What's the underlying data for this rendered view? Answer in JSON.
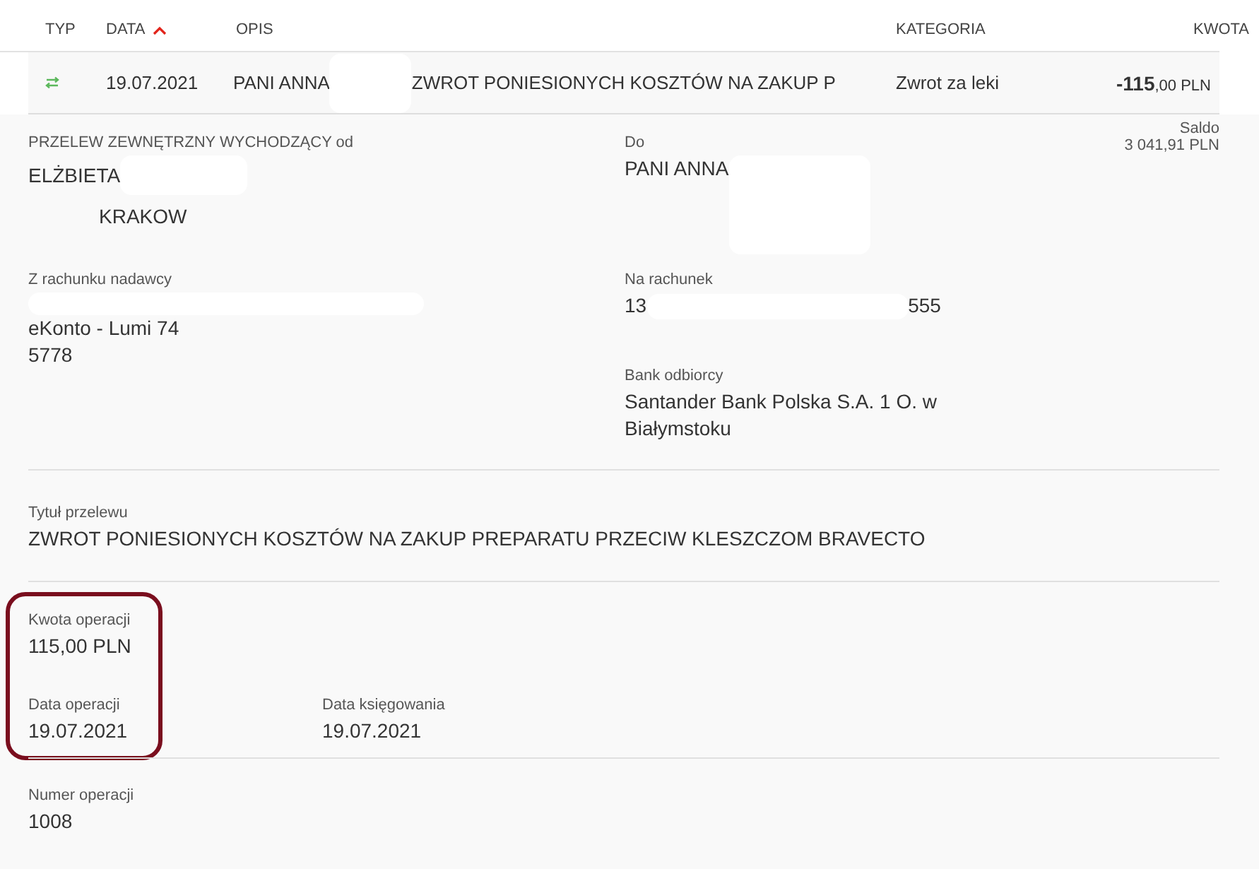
{
  "table": {
    "columns": [
      {
        "label": "TYP",
        "sorted": false
      },
      {
        "label": "DATA",
        "sorted": true
      },
      {
        "label": "OPIS",
        "sorted": false
      },
      {
        "label": "KATEGORIA",
        "sorted": false
      },
      {
        "label": "KWOTA",
        "sorted": false
      }
    ],
    "row": {
      "date": "19.07.2021",
      "name": "PANI ANNA",
      "description": "ZWROT PONIESIONYCH KOSZTÓW NA ZAKUP P",
      "category": "Zwrot za leki",
      "amount": "**-115**,00 PLN"
    }
  },
  "details": {
    "sender": {
      "label": "PRZELEW ZEWNĘTRZNY WYCHODZĄCY od",
      "name": "ELŻBIETA",
      "city": "KRAKOW"
    },
    "recipient": {
      "label": "Do",
      "name": "PANI ANNA"
    },
    "balance": {
      "label": "Saldo",
      "value": "3 041,91 PLN"
    },
    "from_account": {
      "label": "Z rachunku nadawcy",
      "lines": [
        "eKonto - Lumi 74",
        "5778"
      ]
    },
    "to_account": {
      "label": "Na rachunek",
      "start": "13",
      "end": "555"
    },
    "bank": {
      "label": "Bank odbiorcy",
      "value": "Santander Bank Polska S.A. 1 O. w Białymstoku"
    },
    "title": {
      "label": "Tytuł przelewu",
      "value": "ZWROT PONIESIONYCH KOSZTÓW NA ZAKUP PREPARATU PRZECIW KLESZCZOM BRAVECTO"
    },
    "highlighted": true,
    "amount": {
      "label": "Kwota operacji",
      "value": "115,00 PLN"
    },
    "operation_date": {
      "label": "Data operacji",
      "value": "19.07.2021"
    },
    "booking_date": {
      "label": "Data księgowania",
      "value": "19.07.2021"
    },
    "number": {
      "label": "Numer operacji",
      "value": "1008"
    }
  }
}
